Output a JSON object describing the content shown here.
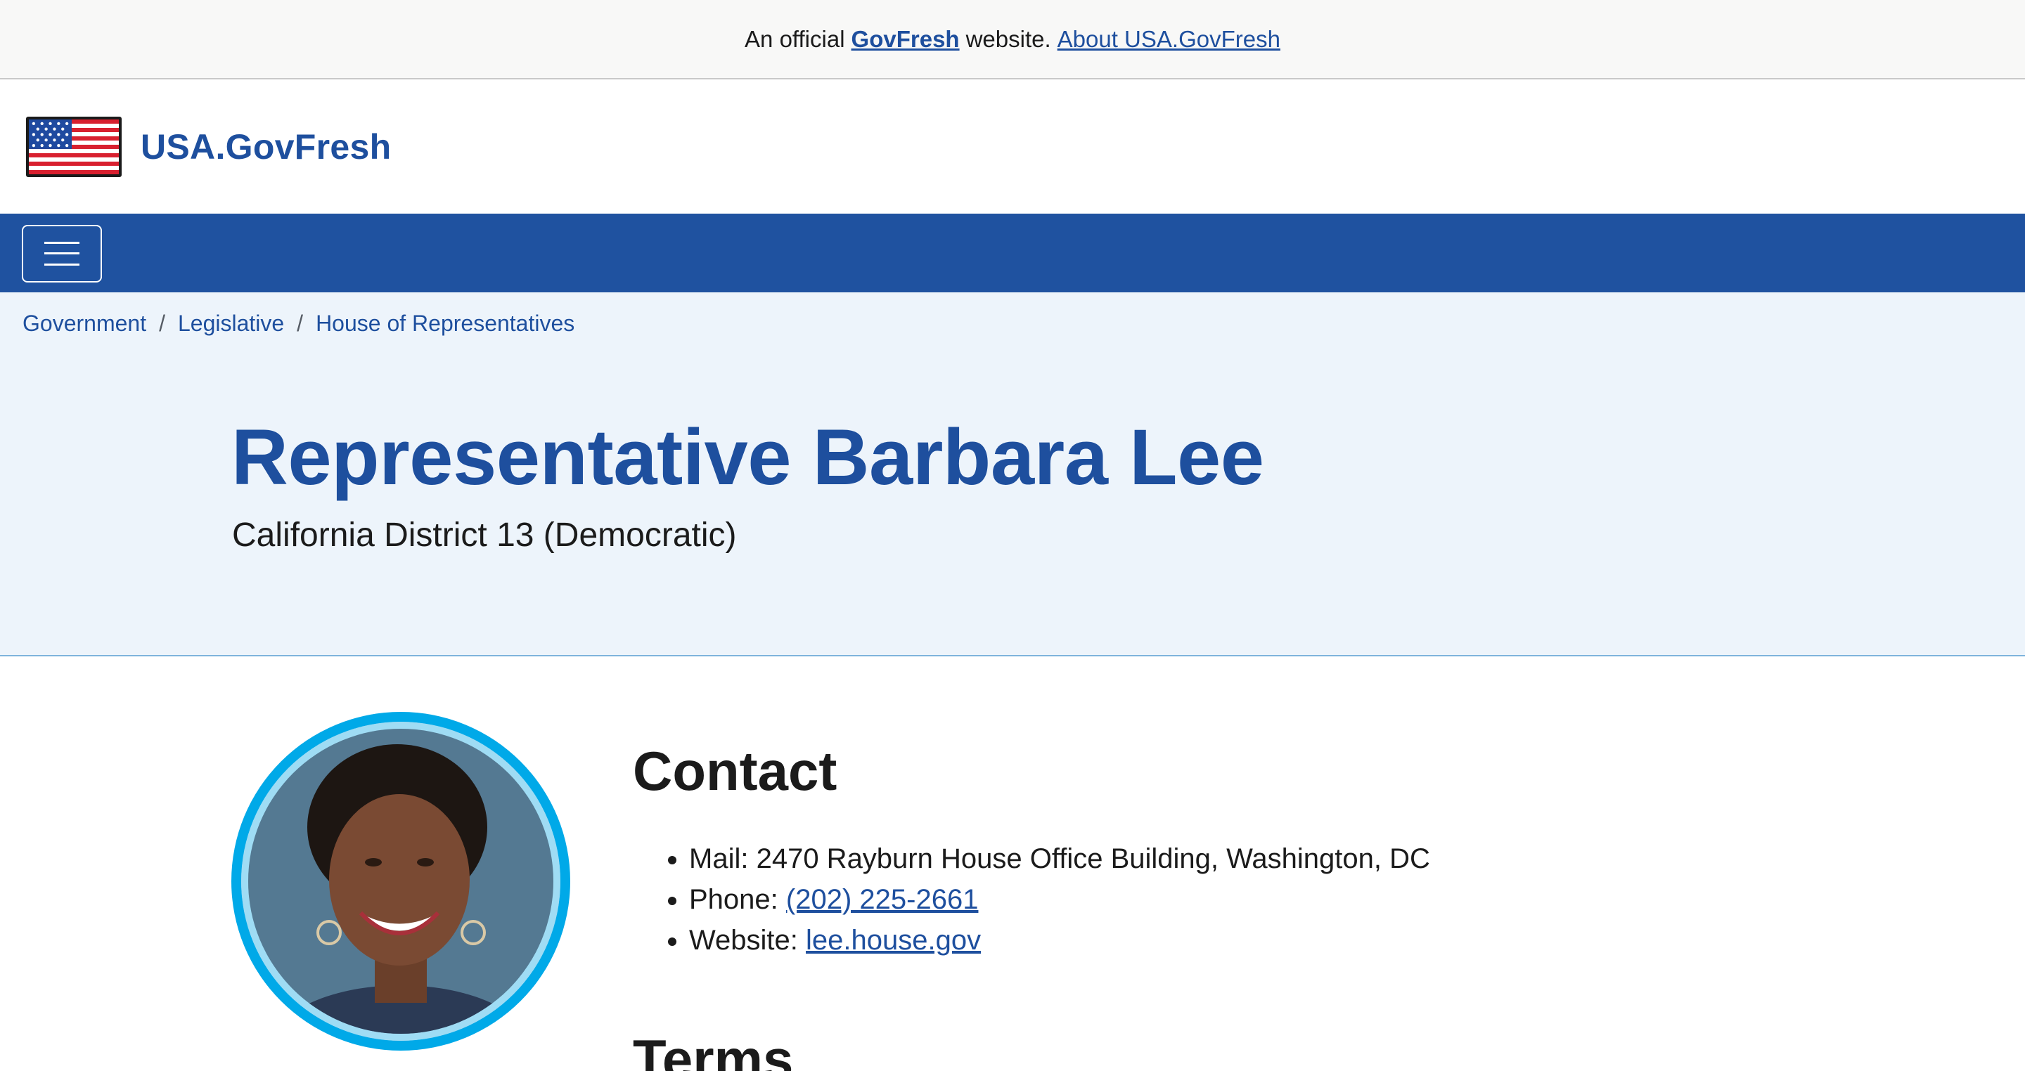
{
  "banner": {
    "prefix": "An official",
    "brand": "GovFresh",
    "suffix": "website.",
    "about_link": "About USA.GovFresh"
  },
  "header": {
    "site_title": "USA.GovFresh",
    "logo_icon": "us-flag-icon"
  },
  "nav": {
    "menu_icon": "hamburger-icon"
  },
  "breadcrumb": {
    "items": [
      "Government",
      "Legislative",
      "House of Representatives"
    ],
    "separator": "/"
  },
  "hero": {
    "title": "Representative Barbara Lee",
    "subtitle": "California District 13 (Democratic)"
  },
  "contact": {
    "heading": "Contact",
    "mail_label": "Mail:",
    "mail_value": "2470 Rayburn House Office Building, Washington, DC",
    "phone_label": "Phone:",
    "phone_value": "(202) 225-2661",
    "website_label": "Website:",
    "website_value": "lee.house.gov"
  },
  "terms": {
    "heading": "Terms"
  },
  "colors": {
    "primary": "#1e4f9e",
    "nav_bg": "#1f52a0",
    "hero_bg": "#edf4fb",
    "portrait_ring": "#00a9e8"
  }
}
